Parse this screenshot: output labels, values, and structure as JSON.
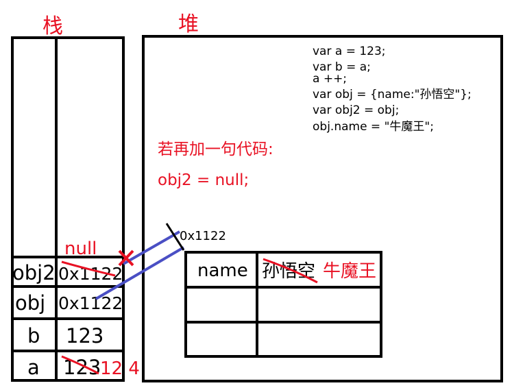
{
  "labels": {
    "stack_title": "栈",
    "heap_title": "堆",
    "note_line1": "若再加一句代码:",
    "note_line2": "obj2 = null;",
    "address": "0x1122"
  },
  "code_lines": [
    "var a = 123;",
    "var b = a;",
    "a ++;",
    "var obj = {name:\"孙悟空\"};",
    "var obj2 = obj;",
    "obj.name = \"牛魔王\";"
  ],
  "stack_rows": [
    {
      "name": "obj2",
      "value": "0x1122",
      "new_value": "null"
    },
    {
      "name": "obj",
      "value": "0x1122"
    },
    {
      "name": "b",
      "value": "123"
    },
    {
      "name": "a",
      "value": "123",
      "new_value": "12 4"
    }
  ],
  "heap_object": {
    "key": "name",
    "old_value": "孙悟空",
    "new_value": "牛魔王"
  },
  "colors": {
    "ink": "#000000",
    "annotation": "#e81123",
    "arrow": "#4a4fc4"
  }
}
